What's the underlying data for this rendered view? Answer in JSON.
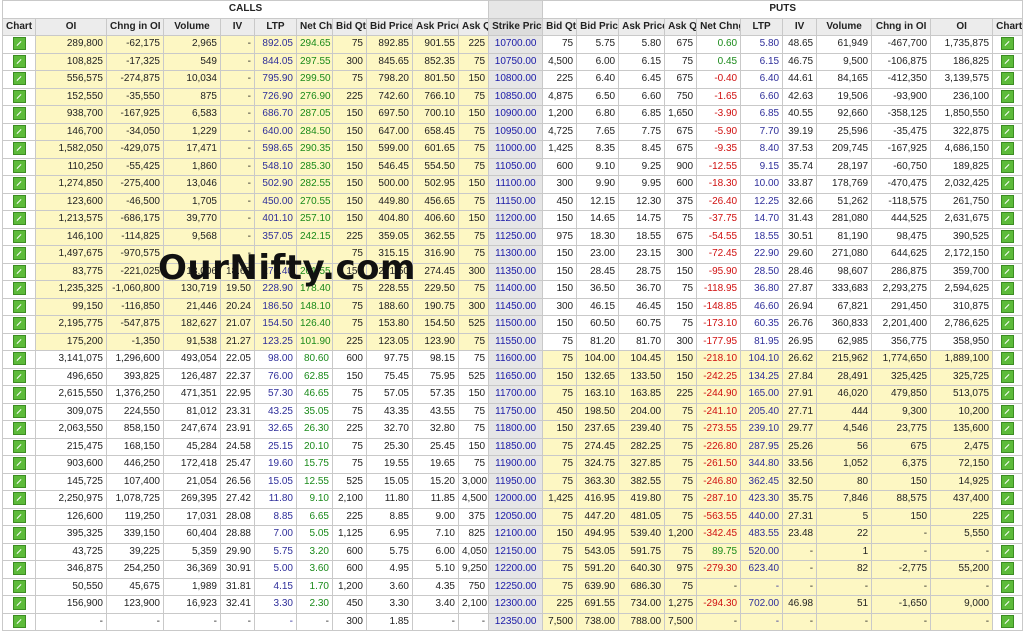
{
  "groups": {
    "calls": "CALLS",
    "puts": "PUTS"
  },
  "watermark": "OurNifty.com",
  "colors": {
    "itm": "#fdf7c3",
    "strike_bg": "#e6e6e6",
    "positive": "#1a8a1a",
    "negative": "#d01010",
    "ltp": "#2e2e9a"
  },
  "columns": [
    "Chart",
    "OI",
    "Chng in OI",
    "Volume",
    "IV",
    "LTP",
    "Net Chng",
    "Bid Qty",
    "Bid Price",
    "Ask Price",
    "Ask Qty",
    "Strike Price",
    "Bid Qty",
    "Bid Price",
    "Ask Price",
    "Ask Qty",
    "Net Chng",
    "LTP",
    "IV",
    "Volume",
    "Chng in OI",
    "OI",
    "Chart"
  ],
  "chart_icon": "chart-icon",
  "rows": [
    [
      "289,800",
      "-62,175",
      "2,965",
      "-",
      "892.05",
      "294.65",
      "75",
      "892.85",
      "901.55",
      "225",
      "10700.00",
      "75",
      "5.75",
      "5.80",
      "675",
      "0.60",
      "5.80",
      "48.65",
      "61,949",
      "-467,700",
      "1,735,875"
    ],
    [
      "108,825",
      "-17,325",
      "549",
      "-",
      "844.05",
      "297.55",
      "300",
      "845.65",
      "852.35",
      "75",
      "10750.00",
      "4,500",
      "6.00",
      "6.15",
      "75",
      "0.45",
      "6.15",
      "46.75",
      "9,500",
      "-106,875",
      "186,825"
    ],
    [
      "556,575",
      "-274,875",
      "10,034",
      "-",
      "795.90",
      "299.50",
      "75",
      "798.20",
      "801.50",
      "150",
      "10800.00",
      "225",
      "6.40",
      "6.45",
      "675",
      "-0.40",
      "6.40",
      "44.61",
      "84,165",
      "-412,350",
      "3,139,575"
    ],
    [
      "152,550",
      "-35,550",
      "875",
      "-",
      "726.90",
      "276.90",
      "225",
      "742.60",
      "766.10",
      "75",
      "10850.00",
      "4,875",
      "6.50",
      "6.60",
      "750",
      "-1.65",
      "6.60",
      "42.63",
      "19,506",
      "-93,900",
      "236,100"
    ],
    [
      "938,700",
      "-167,925",
      "6,583",
      "-",
      "686.70",
      "287.05",
      "150",
      "697.50",
      "700.10",
      "150",
      "10900.00",
      "1,200",
      "6.80",
      "6.85",
      "1,650",
      "-3.90",
      "6.85",
      "40.55",
      "92,660",
      "-358,125",
      "1,850,550"
    ],
    [
      "146,700",
      "-34,050",
      "1,229",
      "-",
      "640.00",
      "284.50",
      "150",
      "647.00",
      "658.45",
      "75",
      "10950.00",
      "4,725",
      "7.65",
      "7.75",
      "675",
      "-5.90",
      "7.70",
      "39.19",
      "25,596",
      "-35,475",
      "322,875"
    ],
    [
      "1,582,050",
      "-429,075",
      "17,471",
      "-",
      "598.65",
      "290.35",
      "150",
      "599.00",
      "601.65",
      "75",
      "11000.00",
      "1,425",
      "8.35",
      "8.45",
      "675",
      "-9.35",
      "8.40",
      "37.53",
      "209,745",
      "-167,925",
      "4,686,150"
    ],
    [
      "110,250",
      "-55,425",
      "1,860",
      "-",
      "548.10",
      "285.30",
      "150",
      "546.45",
      "554.50",
      "75",
      "11050.00",
      "600",
      "9.10",
      "9.25",
      "900",
      "-12.55",
      "9.15",
      "35.74",
      "28,197",
      "-60,750",
      "189,825"
    ],
    [
      "1,274,850",
      "-275,400",
      "13,046",
      "-",
      "502.90",
      "282.55",
      "150",
      "500.00",
      "502.95",
      "150",
      "11100.00",
      "300",
      "9.90",
      "9.95",
      "600",
      "-18.30",
      "10.00",
      "33.87",
      "178,769",
      "-470,475",
      "2,032,425"
    ],
    [
      "123,600",
      "-46,500",
      "1,705",
      "-",
      "450.00",
      "270.55",
      "150",
      "449.80",
      "456.65",
      "75",
      "11150.00",
      "450",
      "12.15",
      "12.30",
      "375",
      "-26.40",
      "12.25",
      "32.66",
      "51,262",
      "-118,575",
      "261,750"
    ],
    [
      "1,213,575",
      "-686,175",
      "39,770",
      "-",
      "401.10",
      "257.10",
      "150",
      "404.80",
      "406.60",
      "150",
      "11200.00",
      "150",
      "14.65",
      "14.75",
      "75",
      "-37.75",
      "14.70",
      "31.43",
      "281,080",
      "444,525",
      "2,631,675"
    ],
    [
      "146,100",
      "-114,825",
      "9,568",
      "-",
      "357.05",
      "242.15",
      "225",
      "359.05",
      "362.55",
      "75",
      "11250.00",
      "975",
      "18.30",
      "18.55",
      "675",
      "-54.55",
      "18.55",
      "30.51",
      "81,190",
      "98,475",
      "390,525"
    ],
    [
      "1,497,675",
      "-970,575",
      "",
      "-",
      "",
      "",
      "75",
      "315.15",
      "316.90",
      "75",
      "11300.00",
      "150",
      "23.00",
      "23.15",
      "300",
      "-72.45",
      "22.90",
      "29.60",
      "271,080",
      "644,625",
      "2,172,150"
    ],
    [
      "83,775",
      "-221,025",
      "13,006",
      "18.69",
      "270.40",
      "201.55",
      "150",
      "271.50",
      "274.45",
      "300",
      "11350.00",
      "150",
      "28.45",
      "28.75",
      "150",
      "-95.90",
      "28.50",
      "28.46",
      "98,607",
      "286,875",
      "359,700"
    ],
    [
      "1,235,325",
      "-1,060,800",
      "130,719",
      "19.50",
      "228.90",
      "178.40",
      "75",
      "228.55",
      "229.50",
      "75",
      "11400.00",
      "150",
      "36.50",
      "36.70",
      "75",
      "-118.95",
      "36.80",
      "27.87",
      "333,683",
      "2,293,275",
      "2,594,625"
    ],
    [
      "99,150",
      "-116,850",
      "21,446",
      "20.24",
      "186.50",
      "148.10",
      "75",
      "188.60",
      "190.75",
      "300",
      "11450.00",
      "300",
      "46.15",
      "46.45",
      "150",
      "-148.85",
      "46.60",
      "26.94",
      "67,821",
      "291,450",
      "310,875"
    ],
    [
      "2,195,775",
      "-547,875",
      "182,627",
      "21.07",
      "154.50",
      "126.40",
      "75",
      "153.80",
      "154.50",
      "525",
      "11500.00",
      "150",
      "60.50",
      "60.75",
      "75",
      "-173.10",
      "60.35",
      "26.76",
      "360,833",
      "2,201,400",
      "2,786,625"
    ],
    [
      "175,200",
      "-1,350",
      "91,538",
      "21.27",
      "123.25",
      "101.90",
      "225",
      "123.05",
      "123.90",
      "75",
      "11550.00",
      "75",
      "81.20",
      "81.70",
      "300",
      "-177.95",
      "81.95",
      "26.95",
      "62,985",
      "356,775",
      "358,950"
    ],
    [
      "3,141,075",
      "1,296,600",
      "493,054",
      "22.05",
      "98.00",
      "80.60",
      "600",
      "97.75",
      "98.15",
      "75",
      "11600.00",
      "75",
      "104.00",
      "104.45",
      "150",
      "-218.10",
      "104.10",
      "26.62",
      "215,962",
      "1,774,650",
      "1,889,100"
    ],
    [
      "496,650",
      "393,825",
      "126,487",
      "22.37",
      "76.00",
      "62.85",
      "150",
      "75.45",
      "75.95",
      "525",
      "11650.00",
      "150",
      "132.65",
      "133.50",
      "150",
      "-242.25",
      "134.25",
      "27.84",
      "28,491",
      "325,425",
      "325,725"
    ],
    [
      "2,615,550",
      "1,376,250",
      "471,351",
      "22.95",
      "57.30",
      "46.65",
      "75",
      "57.05",
      "57.35",
      "150",
      "11700.00",
      "75",
      "163.10",
      "163.85",
      "225",
      "-244.90",
      "165.00",
      "27.91",
      "46,020",
      "479,850",
      "513,075"
    ],
    [
      "309,075",
      "224,550",
      "81,012",
      "23.31",
      "43.25",
      "35.05",
      "75",
      "43.35",
      "43.55",
      "75",
      "11750.00",
      "450",
      "198.50",
      "204.00",
      "75",
      "-241.10",
      "205.40",
      "27.71",
      "444",
      "9,300",
      "10,200"
    ],
    [
      "2,063,550",
      "858,150",
      "247,674",
      "23.91",
      "32.65",
      "26.30",
      "225",
      "32.70",
      "32.80",
      "75",
      "11800.00",
      "150",
      "237.65",
      "239.40",
      "75",
      "-273.55",
      "239.10",
      "29.77",
      "4,546",
      "23,775",
      "135,600"
    ],
    [
      "215,475",
      "168,150",
      "45,284",
      "24.58",
      "25.15",
      "20.10",
      "75",
      "25.30",
      "25.45",
      "150",
      "11850.00",
      "75",
      "274.45",
      "282.25",
      "75",
      "-226.80",
      "287.95",
      "25.26",
      "56",
      "675",
      "2,475"
    ],
    [
      "903,600",
      "446,250",
      "172,418",
      "25.47",
      "19.60",
      "15.75",
      "75",
      "19.55",
      "19.65",
      "75",
      "11900.00",
      "75",
      "324.75",
      "327.85",
      "75",
      "-261.50",
      "344.80",
      "33.56",
      "1,052",
      "6,375",
      "72,150"
    ],
    [
      "145,725",
      "107,400",
      "21,054",
      "26.56",
      "15.05",
      "12.55",
      "525",
      "15.05",
      "15.20",
      "3,000",
      "11950.00",
      "75",
      "363.30",
      "382.55",
      "75",
      "-246.80",
      "362.45",
      "32.50",
      "80",
      "150",
      "14,925"
    ],
    [
      "2,250,975",
      "1,078,725",
      "269,395",
      "27.42",
      "11.80",
      "9.10",
      "2,100",
      "11.80",
      "11.85",
      "4,500",
      "12000.00",
      "1,425",
      "416.95",
      "419.80",
      "75",
      "-287.10",
      "423.30",
      "35.75",
      "7,846",
      "88,575",
      "437,400"
    ],
    [
      "126,600",
      "119,250",
      "17,031",
      "28.08",
      "8.85",
      "6.65",
      "225",
      "8.85",
      "9.00",
      "375",
      "12050.00",
      "75",
      "447.20",
      "481.05",
      "75",
      "-563.55",
      "440.00",
      "27.31",
      "5",
      "150",
      "225"
    ],
    [
      "395,325",
      "339,150",
      "60,404",
      "28.88",
      "7.00",
      "5.05",
      "1,125",
      "6.95",
      "7.10",
      "825",
      "12100.00",
      "150",
      "494.95",
      "539.40",
      "1,200",
      "-342.45",
      "483.55",
      "23.48",
      "22",
      "-",
      "5,550"
    ],
    [
      "43,725",
      "39,225",
      "5,359",
      "29.90",
      "5.75",
      "3.20",
      "600",
      "5.75",
      "6.00",
      "4,050",
      "12150.00",
      "75",
      "543.05",
      "591.75",
      "75",
      "89.75",
      "520.00",
      "-",
      "1",
      "-",
      "-"
    ],
    [
      "346,875",
      "254,250",
      "36,369",
      "30.91",
      "5.00",
      "3.60",
      "600",
      "4.95",
      "5.10",
      "9,250",
      "12200.00",
      "75",
      "591.20",
      "640.30",
      "975",
      "-279.30",
      "623.40",
      "-",
      "82",
      "-2,775",
      "55,200"
    ],
    [
      "50,550",
      "45,675",
      "1,989",
      "31.81",
      "4.15",
      "1.70",
      "1,200",
      "3.60",
      "4.35",
      "750",
      "12250.00",
      "75",
      "639.90",
      "686.30",
      "75",
      "-",
      "-",
      "-",
      "-",
      "-",
      "-"
    ],
    [
      "156,900",
      "123,900",
      "16,923",
      "32.41",
      "3.30",
      "2.30",
      "450",
      "3.30",
      "3.40",
      "2,100",
      "12300.00",
      "225",
      "691.55",
      "734.00",
      "1,275",
      "-294.30",
      "702.00",
      "46.98",
      "51",
      "-1,650",
      "9,000"
    ],
    [
      "-",
      "-",
      "-",
      "-",
      "-",
      "-",
      "300",
      "1.85",
      "-",
      "-",
      "12350.00",
      "7,500",
      "738.00",
      "788.00",
      "7,500",
      "-",
      "-",
      "-",
      "-",
      "-",
      "-"
    ]
  ]
}
